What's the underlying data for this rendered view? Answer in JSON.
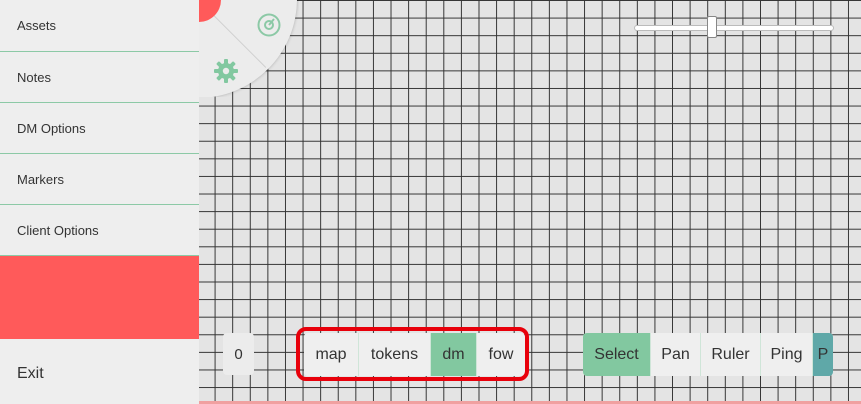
{
  "sidebar": {
    "items": [
      {
        "label": "Assets"
      },
      {
        "label": "Notes"
      },
      {
        "label": "DM Options"
      },
      {
        "label": "Markers"
      },
      {
        "label": "Client Options"
      }
    ],
    "exit_label": "Exit"
  },
  "radial_menu": {
    "icons": [
      "compass-icon",
      "gear-icon"
    ]
  },
  "counter_value": "0",
  "layers": {
    "items": [
      {
        "label": "map",
        "active": false
      },
      {
        "label": "tokens",
        "active": false
      },
      {
        "label": "dm",
        "active": true
      },
      {
        "label": "fow",
        "active": false
      }
    ]
  },
  "tools": {
    "items": [
      {
        "label": "Select",
        "active": true
      },
      {
        "label": "Pan",
        "active": false
      },
      {
        "label": "Ruler",
        "active": false
      },
      {
        "label": "Ping",
        "active": false
      },
      {
        "label": "P",
        "active": false
      }
    ]
  },
  "zoom_slider": {
    "value": 0.38
  },
  "colors": {
    "accent": "#82c8a0",
    "danger": "#ff5a5a",
    "highlight_outline": "#e8000b",
    "teal": "#5fa8a8"
  }
}
